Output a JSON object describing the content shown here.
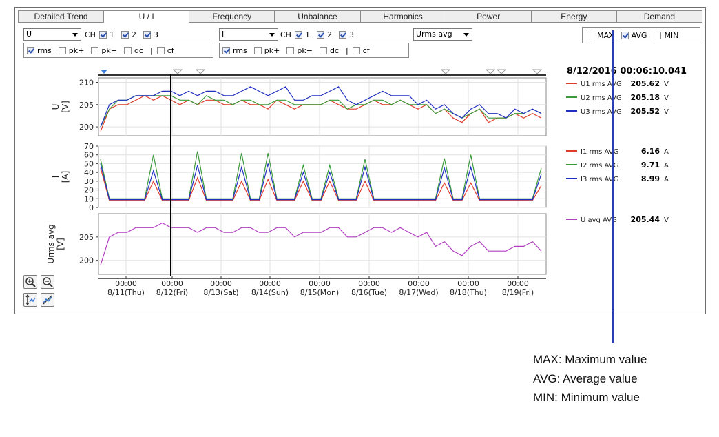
{
  "tabs": [
    "Detailed Trend",
    "U / I",
    "Frequency",
    "Unbalance",
    "Harmonics",
    "Power",
    "Energy",
    "Demand"
  ],
  "active_tab": 1,
  "left_controls": {
    "combo_value": "U",
    "ch_label": "CH",
    "channels": [
      "1",
      "2",
      "3"
    ],
    "options": [
      "rms",
      "pk+",
      "pk−",
      "dc",
      "cf"
    ],
    "options_checked": [
      true,
      false,
      false,
      false,
      false
    ]
  },
  "mid_controls": {
    "combo_value": "I",
    "ch_label": "CH",
    "channels": [
      "1",
      "2",
      "3"
    ],
    "options": [
      "rms",
      "pk+",
      "pk−",
      "dc",
      "cf"
    ],
    "options_checked": [
      true,
      false,
      false,
      false,
      false
    ]
  },
  "mode_combo": "Urms avg",
  "stat_toggles": [
    {
      "label": "MAX",
      "checked": false
    },
    {
      "label": "AVG",
      "checked": true
    },
    {
      "label": "MIN",
      "checked": false
    }
  ],
  "cursor_time": "8/12/2016 00:06:10.041",
  "legend_u": [
    {
      "name": "U1 rms AVG",
      "value": "205.62",
      "unit": "V",
      "color": "#e03c2c"
    },
    {
      "name": "U2 rms AVG",
      "value": "205.18",
      "unit": "V",
      "color": "#3a9a3a"
    },
    {
      "name": "U3 rms AVG",
      "value": "205.52",
      "unit": "V",
      "color": "#2030c0"
    }
  ],
  "legend_i": [
    {
      "name": "I1 rms AVG",
      "value": "6.16",
      "unit": "A",
      "color": "#e03c2c"
    },
    {
      "name": "I2 rms AVG",
      "value": "9.71",
      "unit": "A",
      "color": "#3a9a3a"
    },
    {
      "name": "I3 rms AVG",
      "value": "8.99",
      "unit": "A",
      "color": "#2030c0"
    }
  ],
  "legend_uavg": [
    {
      "name": "U avg AVG",
      "value": "205.44",
      "unit": "V",
      "color": "#b040c0"
    }
  ],
  "x_ticks": [
    {
      "time": "00:00",
      "date": "8/11(Thu)"
    },
    {
      "time": "00:00",
      "date": "8/12(Fri)"
    },
    {
      "time": "00:00",
      "date": "8/13(Sat)"
    },
    {
      "time": "00:00",
      "date": "8/14(Sun)"
    },
    {
      "time": "00:00",
      "date": "8/15(Mon)"
    },
    {
      "time": "00:00",
      "date": "8/16(Tue)"
    },
    {
      "time": "00:00",
      "date": "8/17(Wed)"
    },
    {
      "time": "00:00",
      "date": "8/18(Thu)"
    },
    {
      "time": "00:00",
      "date": "8/19(Fri)"
    }
  ],
  "chart_data": [
    {
      "type": "line",
      "ylabel": [
        "U",
        "[V]"
      ],
      "yticks": [
        200,
        205,
        210
      ],
      "ylim": [
        198,
        211
      ],
      "series": [
        {
          "name": "U1 rms AVG",
          "color": "#e03c2c",
          "values": [
            199,
            204,
            205,
            205,
            206,
            207,
            206,
            207,
            206,
            205,
            206,
            205,
            206,
            206,
            205,
            205,
            206,
            205,
            205,
            204,
            206,
            205,
            204,
            205,
            205,
            205,
            206,
            205,
            204,
            204,
            205,
            206,
            205,
            205,
            206,
            205,
            204,
            205,
            203,
            204,
            202,
            201,
            203,
            204,
            201,
            202,
            202,
            203,
            202,
            203,
            202
          ]
        },
        {
          "name": "U2 rms AVG",
          "color": "#3a9a3a",
          "values": [
            200,
            204,
            206,
            206,
            207,
            207,
            207,
            207,
            207,
            206,
            206,
            205,
            207,
            206,
            206,
            205,
            206,
            206,
            205,
            205,
            206,
            206,
            205,
            205,
            205,
            205,
            206,
            206,
            204,
            205,
            205,
            206,
            206,
            205,
            206,
            205,
            205,
            205,
            203,
            204,
            203,
            202,
            203,
            204,
            202,
            202,
            202,
            203,
            203,
            204,
            203
          ]
        },
        {
          "name": "U3 rms AVG",
          "color": "#2030c0",
          "values": [
            200,
            205,
            206,
            206,
            207,
            207,
            207,
            208,
            208,
            207,
            208,
            207,
            208,
            208,
            207,
            207,
            208,
            209,
            208,
            207,
            208,
            209,
            206,
            206,
            207,
            207,
            208,
            209,
            206,
            205,
            206,
            207,
            208,
            207,
            207,
            207,
            205,
            206,
            204,
            205,
            203,
            202,
            204,
            205,
            203,
            203,
            202,
            204,
            203,
            204,
            203
          ]
        }
      ]
    },
    {
      "type": "line",
      "ylabel": [
        "I",
        "[A]"
      ],
      "yticks": [
        0,
        10,
        20,
        30,
        40,
        50,
        60,
        70
      ],
      "ylim": [
        0,
        70
      ],
      "series": [
        {
          "name": "I1 rms AVG",
          "color": "#e03c2c",
          "values": [
            45,
            8,
            8,
            8,
            8,
            8,
            30,
            8,
            8,
            8,
            8,
            34,
            8,
            8,
            8,
            8,
            30,
            8,
            8,
            32,
            8,
            8,
            8,
            30,
            8,
            8,
            30,
            8,
            8,
            8,
            30,
            8,
            8,
            8,
            8,
            8,
            8,
            8,
            8,
            28,
            8,
            8,
            28,
            8,
            8,
            8,
            8,
            8,
            8,
            8,
            25
          ]
        },
        {
          "name": "I2 rms AVG",
          "color": "#3a9a3a",
          "values": [
            55,
            10,
            10,
            10,
            10,
            10,
            60,
            10,
            10,
            10,
            10,
            64,
            10,
            10,
            10,
            10,
            62,
            10,
            10,
            62,
            10,
            10,
            10,
            48,
            10,
            10,
            48,
            10,
            10,
            10,
            55,
            10,
            10,
            10,
            10,
            10,
            10,
            10,
            10,
            56,
            10,
            10,
            60,
            10,
            10,
            10,
            10,
            10,
            10,
            10,
            45
          ]
        },
        {
          "name": "I3 rms AVG",
          "color": "#2030c0",
          "values": [
            50,
            9,
            9,
            9,
            9,
            9,
            42,
            9,
            9,
            9,
            9,
            48,
            9,
            9,
            9,
            9,
            46,
            9,
            9,
            50,
            9,
            9,
            9,
            40,
            9,
            9,
            40,
            9,
            9,
            9,
            46,
            9,
            9,
            9,
            9,
            9,
            9,
            9,
            9,
            45,
            9,
            9,
            46,
            9,
            9,
            9,
            9,
            9,
            9,
            9,
            38
          ]
        }
      ]
    },
    {
      "type": "line",
      "ylabel": [
        "Urms avg",
        "[V]"
      ],
      "yticks": [
        200,
        205
      ],
      "ylim": [
        197,
        210
      ],
      "series": [
        {
          "name": "U avg AVG",
          "color": "#b040c0",
          "values": [
            199,
            205,
            206,
            206,
            207,
            207,
            207,
            208,
            207,
            207,
            207,
            206,
            207,
            207,
            206,
            206,
            207,
            207,
            206,
            206,
            207,
            207,
            205,
            206,
            206,
            206,
            207,
            207,
            205,
            205,
            206,
            207,
            207,
            206,
            207,
            206,
            205,
            206,
            203,
            204,
            202,
            201,
            203,
            204,
            202,
            202,
            202,
            203,
            203,
            204,
            202
          ]
        }
      ]
    }
  ],
  "explain_lines": [
    "MAX: Maximum value",
    "AVG: Average value",
    "MIN: Minimum value"
  ]
}
